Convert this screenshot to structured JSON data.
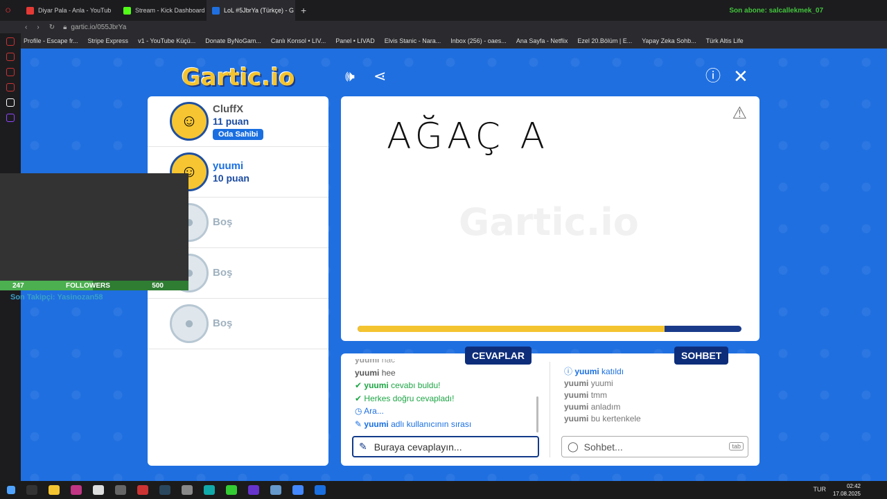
{
  "browser": {
    "tabs": [
      {
        "label": "Diyar Pala - Anla - YouTub",
        "color": "#e53935"
      },
      {
        "label": "Stream - Kick Dashboard",
        "color": "#53fc18"
      },
      {
        "label": "LoL #5JbrYa (Türkçe) - G",
        "color": "#1f6fe0"
      }
    ],
    "url": "gartic.io/055JbrYa",
    "stream_overlay": "Son abone: salcallekmek_07",
    "bookmarks": [
      "Profile - Escape fr...",
      "Stripe Express",
      "v1 - YouTube Küçü...",
      "Donate ByNoGam...",
      "Canlı Konsol • LIV...",
      "Panel • LIVAD",
      "Elvis Stanic - Nara...",
      "Inbox (256) - oaes...",
      "Ana Sayfa - Netflix",
      "Ezel 20.Bölüm | E...",
      "Yapay Zeka Sohb...",
      "Türk Altis Life"
    ]
  },
  "game": {
    "logo": "Gartic.io",
    "players": [
      {
        "name": "CluffX",
        "points": "11 puan",
        "badge": "Oda Sahibi"
      },
      {
        "name": "yuumi",
        "points": "10 puan"
      },
      {
        "empty_label": "Boş"
      },
      {
        "empty_label": "Boş"
      },
      {
        "empty_label": "Boş"
      }
    ],
    "drawing_text": "AĞAÇ A",
    "watermark": "Gartic.io",
    "progress_fraction": 0.8,
    "answers_tab": "CEVAPLAR",
    "chat_tab": "SOHBET",
    "answers": [
      {
        "user": "yuumi",
        "text": "hac"
      },
      {
        "user": "yuumi",
        "text": "hee"
      },
      {
        "user": "yuumi",
        "text": "cevabı buldu!"
      },
      {
        "text": "Herkes doğru cevapladı!"
      },
      {
        "text": "Ara..."
      },
      {
        "user": "yuumi",
        "text": "adlı kullanıcının sırası"
      }
    ],
    "chat": [
      {
        "user": "yuumi",
        "text": "katıldı"
      },
      {
        "user": "yuumi",
        "text": "yuumi"
      },
      {
        "user": "yuumi",
        "text": "tmm"
      },
      {
        "user": "yuumi",
        "text": "anladım"
      },
      {
        "user": "yuumi",
        "text": "bu kertenkele"
      }
    ],
    "answer_placeholder": "Buraya cevaplayın...",
    "chat_placeholder": "Sohbet...",
    "tab_key": "tab"
  },
  "overlay": {
    "followers_current": "247",
    "followers_label": "FOLLOWERS",
    "followers_goal": "500",
    "followers_fraction": 0.494,
    "last_follower": "Son Takipçi: Yasinozan58"
  },
  "taskbar": {
    "lang": "TUR",
    "time": "02:42",
    "date": "17.08.2025"
  },
  "colors": {
    "game_bg": "#1f6fe0",
    "accent_dark": "#0d2d7a",
    "progress": "#f4c430",
    "success": "#1ea545"
  }
}
